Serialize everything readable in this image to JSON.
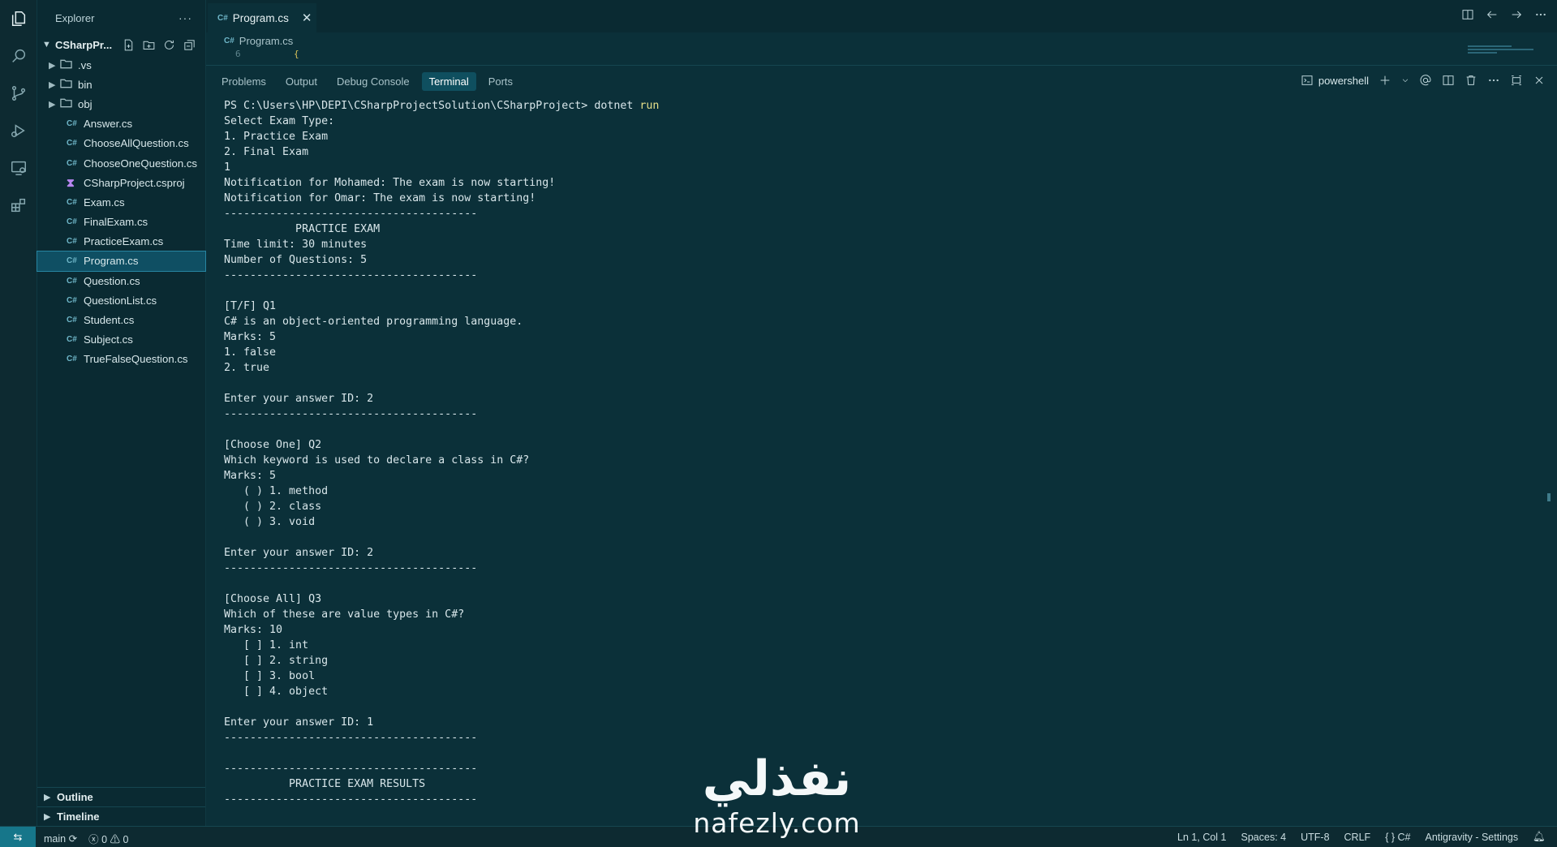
{
  "sidebar": {
    "title": "Explorer",
    "more": "···",
    "project": "CSharpPr...",
    "items": [
      {
        "type": "folder",
        "label": ".vs"
      },
      {
        "type": "folder",
        "label": "bin"
      },
      {
        "type": "folder",
        "label": "obj"
      },
      {
        "type": "cs",
        "label": "Answer.cs"
      },
      {
        "type": "cs",
        "label": "ChooseAllQuestion.cs"
      },
      {
        "type": "cs",
        "label": "ChooseOneQuestion.cs"
      },
      {
        "type": "proj",
        "label": "CSharpProject.csproj"
      },
      {
        "type": "cs",
        "label": "Exam.cs"
      },
      {
        "type": "cs",
        "label": "FinalExam.cs"
      },
      {
        "type": "cs",
        "label": "PracticeExam.cs"
      },
      {
        "type": "cs",
        "label": "Program.cs",
        "selected": true
      },
      {
        "type": "cs",
        "label": "Question.cs"
      },
      {
        "type": "cs",
        "label": "QuestionList.cs"
      },
      {
        "type": "cs",
        "label": "Student.cs"
      },
      {
        "type": "cs",
        "label": "Subject.cs"
      },
      {
        "type": "cs",
        "label": "TrueFalseQuestion.cs"
      }
    ],
    "outline": "Outline",
    "timeline": "Timeline"
  },
  "editor": {
    "lang_badge": "C#",
    "tab_label": "Program.cs",
    "tab_close": "✕",
    "breadcrumb": "Program.cs",
    "line_number": "6",
    "code_fragment": "{"
  },
  "panel": {
    "tabs": [
      "Problems",
      "Output",
      "Debug Console",
      "Terminal",
      "Ports"
    ],
    "active_tab": "Terminal",
    "shell": "powershell",
    "prompt": "PS C:\\Users\\HP\\DEPI\\CSharpProjectSolution\\CSharpProject> ",
    "command": "dotnet",
    "command_arg": "run",
    "output": [
      "Select Exam Type:",
      "1. Practice Exam",
      "2. Final Exam",
      "1",
      "Notification for Mohamed: The exam is now starting!",
      "Notification for Omar: The exam is now starting!",
      "---------------------------------------",
      "           PRACTICE EXAM",
      "Time limit: 30 minutes",
      "Number of Questions: 5",
      "---------------------------------------",
      "",
      "[T/F] Q1",
      "C# is an object-oriented programming language.",
      "Marks: 5",
      "1. false",
      "2. true",
      "",
      "Enter your answer ID: 2",
      "---------------------------------------",
      "",
      "[Choose One] Q2",
      "Which keyword is used to declare a class in C#?",
      "Marks: 5",
      "   ( ) 1. method",
      "   ( ) 2. class",
      "   ( ) 3. void",
      "",
      "Enter your answer ID: 2",
      "---------------------------------------",
      "",
      "[Choose All] Q3",
      "Which of these are value types in C#?",
      "Marks: 10",
      "   [ ] 1. int",
      "   [ ] 2. string",
      "   [ ] 3. bool",
      "   [ ] 4. object",
      "",
      "Enter your answer ID: 1",
      "---------------------------------------",
      "",
      "---------------------------------------",
      "          PRACTICE EXAM RESULTS",
      "---------------------------------------"
    ]
  },
  "status": {
    "branch": "main",
    "errors": "0",
    "warnings": "0",
    "position": "Ln 1, Col 1",
    "spaces": "Spaces: 4",
    "encoding": "UTF-8",
    "eol": "CRLF",
    "language": "C#",
    "extra": "Antigravity - Settings"
  },
  "watermark": {
    "arabic": "نفذلي",
    "url": "nafezly.com"
  }
}
